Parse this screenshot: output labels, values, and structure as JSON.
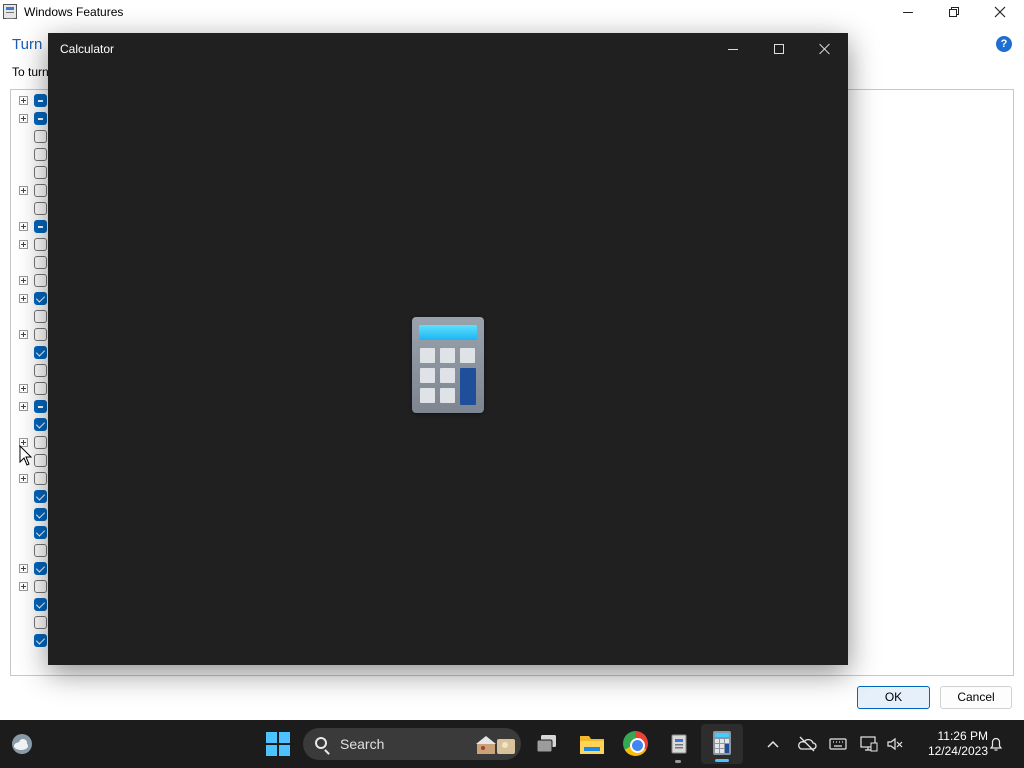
{
  "windows_features": {
    "title": "Windows Features",
    "heading": "Turn",
    "description": "To turn",
    "help_label": "?",
    "ok_label": "OK",
    "cancel_label": "Cancel",
    "rows": [
      {
        "expander": true,
        "state": "partial"
      },
      {
        "expander": true,
        "state": "partial"
      },
      {
        "expander": false,
        "state": "unchecked"
      },
      {
        "expander": false,
        "state": "unchecked"
      },
      {
        "expander": false,
        "state": "unchecked"
      },
      {
        "expander": true,
        "state": "unchecked"
      },
      {
        "expander": false,
        "state": "unchecked"
      },
      {
        "expander": true,
        "state": "partial"
      },
      {
        "expander": true,
        "state": "unchecked"
      },
      {
        "expander": false,
        "state": "unchecked"
      },
      {
        "expander": true,
        "state": "unchecked"
      },
      {
        "expander": true,
        "state": "checked"
      },
      {
        "expander": false,
        "state": "unchecked"
      },
      {
        "expander": true,
        "state": "unchecked"
      },
      {
        "expander": false,
        "state": "checked"
      },
      {
        "expander": false,
        "state": "unchecked"
      },
      {
        "expander": true,
        "state": "unchecked"
      },
      {
        "expander": true,
        "state": "partial"
      },
      {
        "expander": false,
        "state": "checked"
      },
      {
        "expander": true,
        "state": "unchecked"
      },
      {
        "expander": false,
        "state": "unchecked"
      },
      {
        "expander": true,
        "state": "unchecked"
      },
      {
        "expander": false,
        "state": "checked"
      },
      {
        "expander": false,
        "state": "checked"
      },
      {
        "expander": false,
        "state": "checked"
      },
      {
        "expander": false,
        "state": "unchecked"
      },
      {
        "expander": true,
        "state": "checked"
      },
      {
        "expander": true,
        "state": "unchecked"
      },
      {
        "expander": false,
        "state": "checked"
      },
      {
        "expander": false,
        "state": "unchecked"
      },
      {
        "expander": false,
        "state": "checked"
      }
    ]
  },
  "calculator": {
    "title": "Calculator"
  },
  "taskbar": {
    "search_label": "Search",
    "time": "11:26 PM",
    "date": "12/24/2023"
  },
  "colors": {
    "accent": "#0067c0",
    "calculator_bg": "#202020",
    "taskbar_bg": "#1c1c1c",
    "start_blue": "#4cc2ff"
  }
}
